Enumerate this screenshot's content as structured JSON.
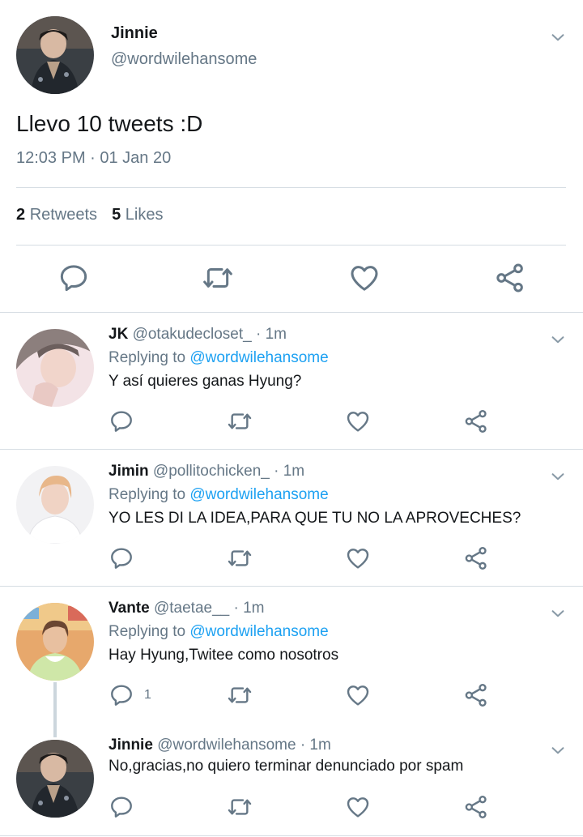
{
  "main_tweet": {
    "author_name": "Jinnie",
    "author_handle": "@wordwilehansome",
    "text": "Llevo 10 tweets :D",
    "timestamp": "12:03 PM · 01 Jan 20",
    "retweets_count": "2",
    "retweets_label": "Retweets",
    "likes_count": "5",
    "likes_label": "Likes",
    "actions": [
      "reply-icon",
      "retweet-icon",
      "like-icon",
      "share-icon"
    ]
  },
  "replies": [
    {
      "name": "JK",
      "handle": "@otakudecloset_ · 1m",
      "replying_prefix": "Replying to",
      "replying_to": "@wordwilehansome",
      "text": "Y así quieres ganas Hyung?",
      "reply_count": ""
    },
    {
      "name": "Jimin",
      "handle": "@pollitochicken_ · 1m",
      "replying_prefix": "Replying to",
      "replying_to": "@wordwilehansome",
      "text": "YO LES DI LA IDEA,PARA QUE TU NO LA APROVECHES?",
      "reply_count": ""
    },
    {
      "name": "Vante",
      "handle": "@taetae__ · 1m",
      "replying_prefix": "Replying to",
      "replying_to": "@wordwilehansome",
      "text": "Hay Hyung,Twitee como nosotros",
      "reply_count": "1"
    },
    {
      "name": "Jinnie",
      "handle": "@wordwilehansome · 1m",
      "text": "No,gracias,no quiero terminar denunciado por spam",
      "reply_count": ""
    }
  ],
  "colors": {
    "text_primary": "#14171a",
    "text_secondary": "#657786",
    "link": "#1da1f2",
    "divider": "#d6dde3"
  }
}
